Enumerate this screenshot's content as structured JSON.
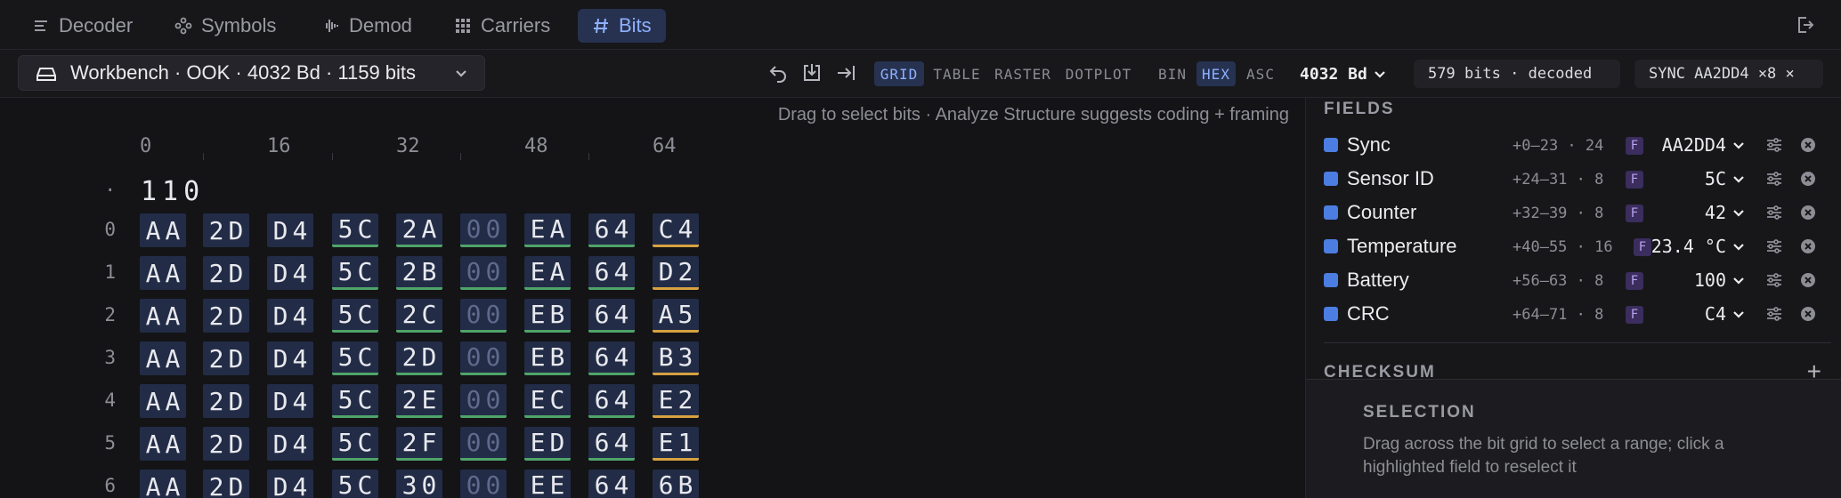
{
  "tabs": [
    {
      "label": "Decoder",
      "icon": "list-icon",
      "active": false
    },
    {
      "label": "Symbols",
      "icon": "symbols-icon",
      "active": false
    },
    {
      "label": "Demod",
      "icon": "waveform-icon",
      "active": false
    },
    {
      "label": "Carriers",
      "icon": "grid-icon",
      "active": false
    },
    {
      "label": "Bits",
      "icon": "hash-icon",
      "active": true
    }
  ],
  "toolbar": {
    "workbench_label": "Workbench · OOK · 4032 Bd · 1159 bits",
    "views": [
      "GRID",
      "TABLE",
      "RASTER",
      "DOTPLOT"
    ],
    "active_view": "GRID",
    "formats": [
      "BIN",
      "HEX",
      "ASC"
    ],
    "active_format": "HEX",
    "baud": "4032 Bd",
    "decoded_status": "579 bits · decoded",
    "sync_status": "SYNC AA2DD4 ×8 ×"
  },
  "grid": {
    "hint": "Drag to select bits · Analyze Structure suggests coding + framing",
    "column_labels": [
      "0",
      "16",
      "32",
      "48",
      "64"
    ],
    "partial_row_label": "·",
    "partial_bits": "110",
    "row_labels": [
      "0",
      "1",
      "2",
      "3",
      "4",
      "5",
      "6"
    ],
    "rows": [
      [
        "AA",
        "2D",
        "D4",
        "5C",
        "2A",
        "00",
        "EA",
        "64",
        "C4"
      ],
      [
        "AA",
        "2D",
        "D4",
        "5C",
        "2B",
        "00",
        "EA",
        "64",
        "D2"
      ],
      [
        "AA",
        "2D",
        "D4",
        "5C",
        "2C",
        "00",
        "EB",
        "64",
        "A5"
      ],
      [
        "AA",
        "2D",
        "D4",
        "5C",
        "2D",
        "00",
        "EB",
        "64",
        "B3"
      ],
      [
        "AA",
        "2D",
        "D4",
        "5C",
        "2E",
        "00",
        "EC",
        "64",
        "E2"
      ],
      [
        "AA",
        "2D",
        "D4",
        "5C",
        "2F",
        "00",
        "ED",
        "64",
        "E1"
      ],
      [
        "AA",
        "2D",
        "D4",
        "5C",
        "30",
        "00",
        "EE",
        "64",
        "6B"
      ]
    ]
  },
  "panel": {
    "fields_title": "FIELDS",
    "fields": [
      {
        "name": "Sync",
        "range": "+0–23 · 24",
        "badge": "F",
        "value": "AA2DD4",
        "color": "#4c7de0"
      },
      {
        "name": "Sensor ID",
        "range": "+24–31 · 8",
        "badge": "F",
        "value": "5C",
        "color": "#4c7de0"
      },
      {
        "name": "Counter",
        "range": "+32–39 · 8",
        "badge": "F",
        "value": "42",
        "color": "#4c7de0"
      },
      {
        "name": "Temperature",
        "range": "+40–55 · 16",
        "badge": "F",
        "value": "23.4 °C",
        "color": "#4c7de0"
      },
      {
        "name": "Battery",
        "range": "+56–63 · 8",
        "badge": "F",
        "value": "100",
        "color": "#4c7de0"
      },
      {
        "name": "CRC",
        "range": "+64–71 · 8",
        "badge": "F",
        "value": "C4",
        "color": "#4c7de0"
      }
    ],
    "checksum_title": "CHECKSUM",
    "add_label": "+",
    "selection_title": "SELECTION",
    "selection_desc": "Drag across the bit grid to select a range; click a highlighted field to reselect it"
  },
  "colors": {
    "accent": "#8fb0ff",
    "accent_bg": "#263250",
    "cell_bg": "#222c47",
    "underline_green": "#4fa46a",
    "underline_orange": "#d7a240",
    "field_swatch": "#4c7de0"
  }
}
